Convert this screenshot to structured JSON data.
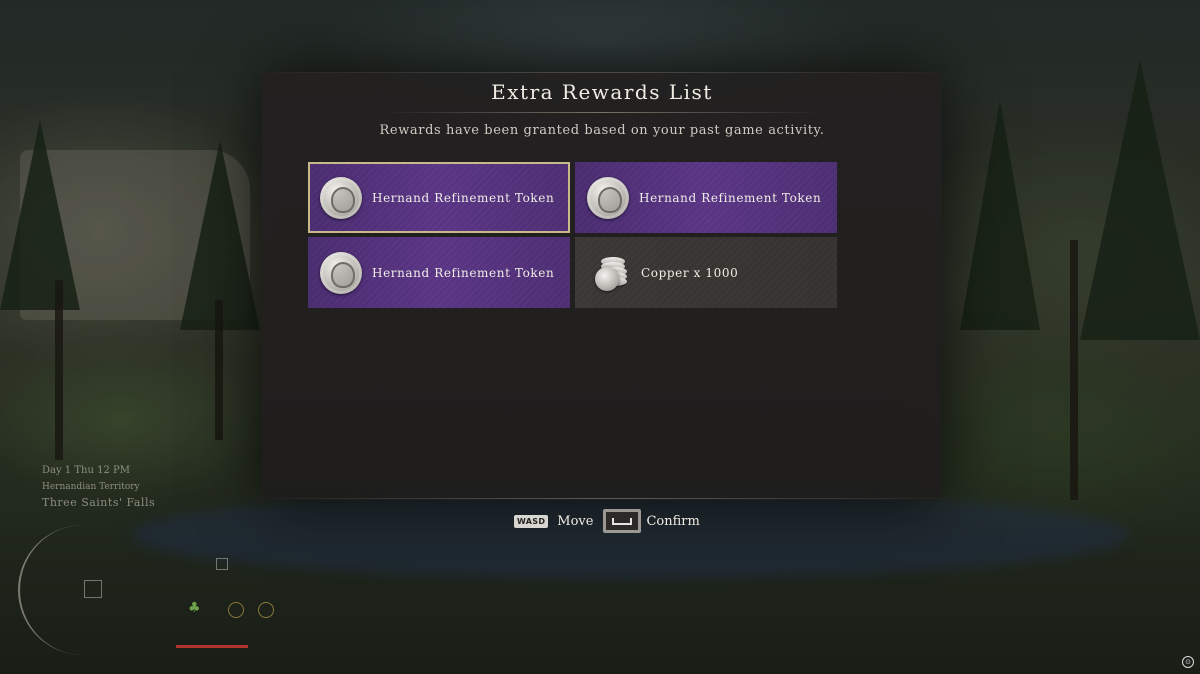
{
  "dialog": {
    "title": "Extra Rewards List",
    "subtitle": "Rewards have been granted based on your past game activity."
  },
  "rewards": [
    {
      "name": "Hernand Refinement Token",
      "icon": "refinement-token-icon",
      "rarity": "rare",
      "selected": true
    },
    {
      "name": "Hernand Refinement Token",
      "icon": "refinement-token-icon",
      "rarity": "rare",
      "selected": false
    },
    {
      "name": "Hernand Refinement Token",
      "icon": "refinement-token-icon",
      "rarity": "rare",
      "selected": false
    },
    {
      "name": "Copper x 1000",
      "icon": "copper-coins-icon",
      "rarity": "common",
      "selected": false
    }
  ],
  "controls": {
    "move_key": "WASD",
    "move_label": "Move",
    "confirm_key": "space-key-icon",
    "confirm_label": "Confirm"
  },
  "hud": {
    "time": "Day 1 Thu 12 PM",
    "region": "Hernandian Territory",
    "location": "Three Saints' Falls"
  },
  "colors": {
    "rare_card": "#5a3585",
    "common_card": "#35322f",
    "selected_border": "#c9b98a"
  }
}
